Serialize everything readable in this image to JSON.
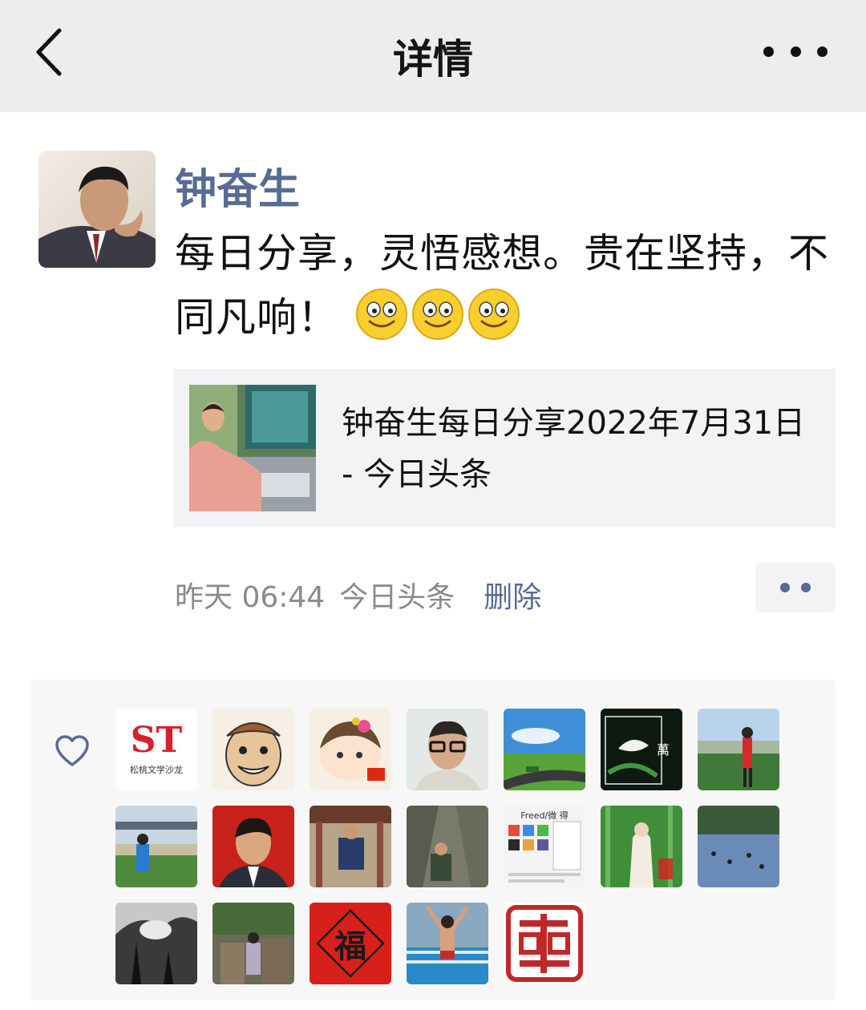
{
  "header": {
    "title": "详情",
    "back_icon": "chevron-left-icon",
    "more_icon": "more-dots-icon"
  },
  "post": {
    "author": "钟奋生",
    "text": "每日分享，灵悟感想。贵在坚持，不同凡响！",
    "emojis": [
      "smile-emoji",
      "smile-emoji",
      "smile-emoji"
    ],
    "link": {
      "title": "钟奋生每日分享2022年7月31日 - 今日头条"
    },
    "meta": {
      "time": "昨天 06:44",
      "source": "今日头条",
      "delete_label": "删除"
    }
  },
  "likes": {
    "icon": "heart-icon",
    "avatars": [
      {
        "name": "liker-st-logo",
        "text": "松桃文学沙龙",
        "big": "ST"
      },
      {
        "name": "liker-cartoon-face"
      },
      {
        "name": "liker-cartoon-girl"
      },
      {
        "name": "liker-man-glasses"
      },
      {
        "name": "liker-landscape-road"
      },
      {
        "name": "liker-fish-dark",
        "text": "萬"
      },
      {
        "name": "liker-woman-seaside"
      },
      {
        "name": "liker-bridge-person"
      },
      {
        "name": "liker-man-red-bg"
      },
      {
        "name": "liker-man-pavilion"
      },
      {
        "name": "liker-man-gorge"
      },
      {
        "name": "liker-screenshot",
        "text": "Freed/微 得"
      },
      {
        "name": "liker-guanyin"
      },
      {
        "name": "liker-pool"
      },
      {
        "name": "liker-bw-trees"
      },
      {
        "name": "liker-person-rocks"
      },
      {
        "name": "liker-fu-card",
        "big": "福"
      },
      {
        "name": "liker-swimmer"
      },
      {
        "name": "liker-seal-stamp"
      }
    ]
  },
  "colors": {
    "link_blue": "#576b95",
    "header_bg": "#ededed",
    "card_bg": "#f3f3f5"
  }
}
